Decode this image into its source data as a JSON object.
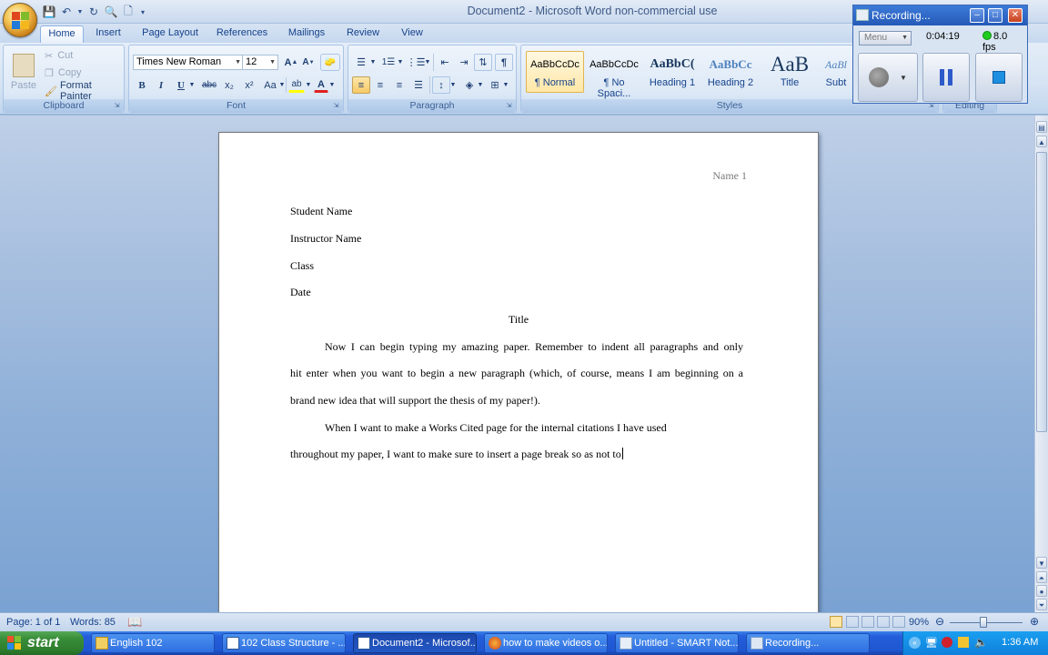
{
  "window": {
    "title": "Document2 - Microsoft Word non-commercial use"
  },
  "tabs": [
    "Home",
    "Insert",
    "Page Layout",
    "References",
    "Mailings",
    "Review",
    "View"
  ],
  "clipboard": {
    "paste": "Paste",
    "cut": "Cut",
    "copy": "Copy",
    "format_painter": "Format Painter",
    "label": "Clipboard"
  },
  "font": {
    "name": "Times New Roman",
    "size": "12",
    "label": "Font",
    "bold": "B",
    "italic": "I",
    "underline": "U",
    "strike": "abc",
    "sub": "x₂",
    "sup": "x²",
    "case": "Aa",
    "color": "A"
  },
  "paragraph": {
    "label": "Paragraph",
    "show": "¶"
  },
  "styles": {
    "label": "Styles",
    "items": [
      {
        "sample": "AaBbCcDc",
        "name": "¶ Normal"
      },
      {
        "sample": "AaBbCcDc",
        "name": "¶ No Spaci..."
      },
      {
        "sample": "AaBbC(",
        "name": "Heading 1"
      },
      {
        "sample": "AaBbCc",
        "name": "Heading 2"
      },
      {
        "sample": "AaB",
        "name": "Title"
      },
      {
        "sample": "AaBl",
        "name": "Subt"
      }
    ]
  },
  "editing": {
    "label": "Editing"
  },
  "recorder": {
    "title": "Recording...",
    "menu": "Menu",
    "time": "0:04:19",
    "fps": "8.0 fps"
  },
  "document": {
    "header": "Name 1",
    "lines": [
      "Student Name",
      "Instructor Name",
      "Class",
      "Date"
    ],
    "title": "Title",
    "para1": [
      "Now I can begin typing my amazing paper.  Remember to indent all paragraphs and only",
      "hit enter when you want to begin a new paragraph (which, of course, means I am beginning on a",
      "brand new idea that will support the thesis of my paper!)."
    ],
    "para2": [
      "When I want to make a Works Cited page for the internal citations I have used",
      "throughout my paper, I want to make sure to insert a page break so as not to"
    ]
  },
  "status": {
    "page": "Page: 1 of 1",
    "words": "Words: 85",
    "zoom": "90%"
  },
  "taskbar": {
    "start": "start",
    "tasks": [
      "English 102",
      "102 Class Structure - ...",
      "Document2 - Microsof...",
      "how to make videos o...",
      "Untitled - SMART Not...",
      "Recording..."
    ],
    "clock": "1:36 AM"
  }
}
